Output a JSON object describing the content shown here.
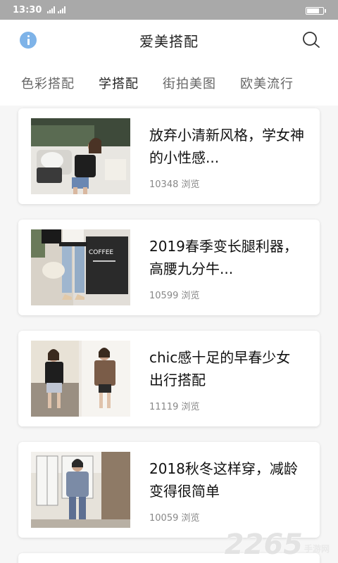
{
  "status_bar": {
    "time": "13:30",
    "battery_level": 0.7
  },
  "app_bar": {
    "title": "爱美搭配"
  },
  "tabs": [
    {
      "label": "色彩搭配",
      "active": false
    },
    {
      "label": "学搭配",
      "active": true
    },
    {
      "label": "街拍美图",
      "active": false
    },
    {
      "label": "欧美流行",
      "active": false
    }
  ],
  "articles": [
    {
      "title": "放弃小清新风格，学女神的小性感...",
      "views": "10348 浏览"
    },
    {
      "title": "2019春季变长腿利器，高腰九分牛...",
      "views": "10599 浏览"
    },
    {
      "title": "chic感十足的早春少女出行搭配",
      "views": "11119 浏览"
    },
    {
      "title": "2018秋冬这样穿，减龄变得很简单",
      "views": "10059 浏览"
    }
  ],
  "watermark": {
    "number": "2265",
    "site": "手游网"
  },
  "colors": {
    "accent_icon": "#7eb3e8",
    "status_bar": "#a9a9a9"
  }
}
